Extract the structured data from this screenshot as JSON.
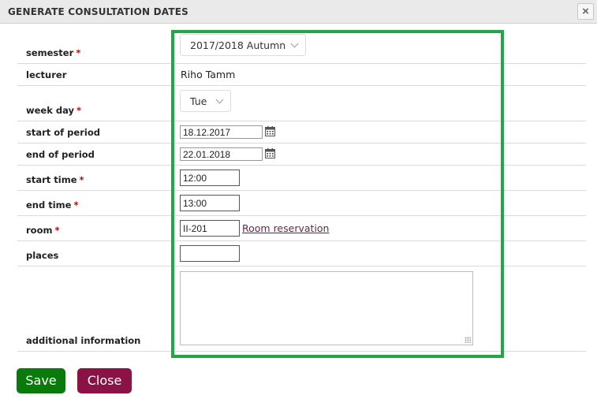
{
  "dialog": {
    "title": "GENERATE CONSULTATION DATES",
    "close_symbol": "×"
  },
  "form": {
    "semester": {
      "label": "semester",
      "required": "*",
      "value": "2017/2018  Autumn"
    },
    "lecturer": {
      "label": "lecturer",
      "value": "Riho Tamm"
    },
    "week_day": {
      "label": "week day",
      "required": "*",
      "value": "Tue"
    },
    "start_of_period": {
      "label": "start of period",
      "value": "18.12.2017"
    },
    "end_of_period": {
      "label": "end of period",
      "value": "22.01.2018"
    },
    "start_time": {
      "label": "start time",
      "required": "*",
      "value": "12:00"
    },
    "end_time": {
      "label": "end time",
      "required": "*",
      "value": "13:00"
    },
    "room": {
      "label": "room",
      "required": "*",
      "value": "II-201",
      "link": "Room reservation"
    },
    "places": {
      "label": "places",
      "value": ""
    },
    "additional_information": {
      "label": "additional information",
      "value": ""
    }
  },
  "buttons": {
    "save": "Save",
    "close": "Close"
  },
  "colors": {
    "highlight": "#1fa845",
    "save": "#0a7a0a",
    "close": "#8a1244",
    "required": "#dd0000",
    "link": "#6b1f4a"
  },
  "icons": {
    "calendar": "calendar-icon",
    "chevron": "chevron-down-icon",
    "close": "close-icon"
  }
}
